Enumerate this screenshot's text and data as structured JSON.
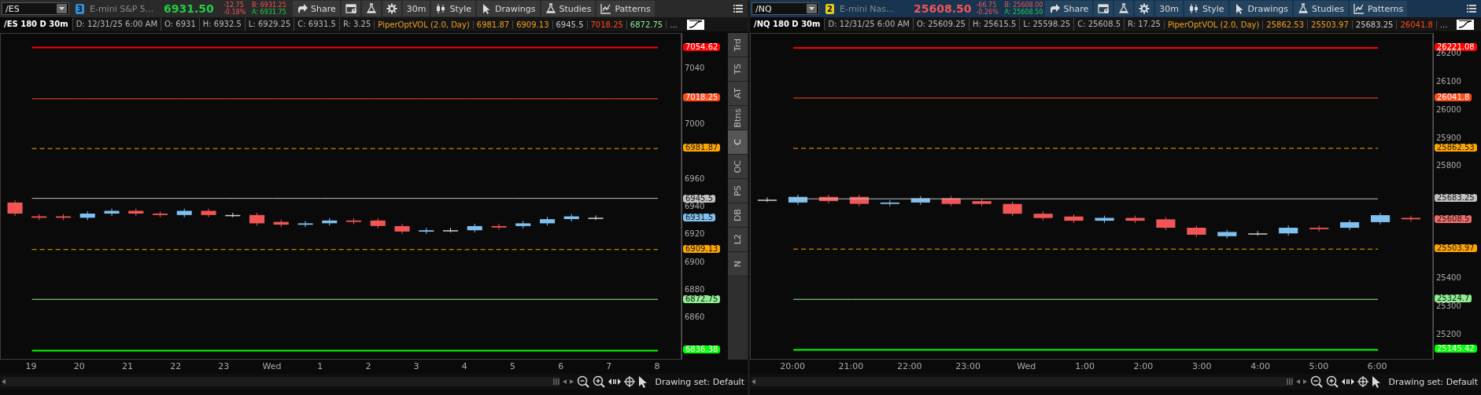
{
  "panels": [
    {
      "active": false,
      "symbol": "/ES",
      "link_badge": {
        "text": "3",
        "color": "#2f8fd8"
      },
      "description": "E-mini S&P 5...",
      "last": {
        "text": "6931.50",
        "up": true
      },
      "change": "-12.75",
      "change_pct": "-0.18%",
      "bid": "B: 6931.25",
      "ask": "A: 6931.75",
      "toolbar": [
        {
          "kind": "share",
          "label": "Share"
        },
        {
          "kind": "alerts"
        },
        {
          "kind": "lab"
        },
        {
          "kind": "settings"
        },
        {
          "kind": "aggregation",
          "label": "30m"
        },
        {
          "kind": "style",
          "label": "Style"
        },
        {
          "kind": "drawings",
          "label": "Drawings"
        },
        {
          "kind": "studies",
          "label": "Studies"
        },
        {
          "kind": "patterns",
          "label": "Patterns"
        }
      ],
      "info": {
        "title": "/ES 180 D 30m",
        "fields": [
          "D: 12/31/25 6:00 AM",
          "O: 6931",
          "H: 6932.5",
          "L: 6929.25",
          "C: 6931.5",
          "R: 3.25"
        ],
        "study": "PiperOptVOL (2.0, Day)",
        "study_values": [
          {
            "text": "6981.87",
            "color": "#f0a020"
          },
          {
            "text": "6909.13",
            "color": "#f0a020"
          },
          {
            "text": "6945.5",
            "color": "#c8c8c8"
          },
          {
            "text": "7018.25",
            "color": "#ff4a1a"
          },
          {
            "text": "6872.75",
            "color": "#90e890"
          }
        ],
        "more": "..."
      },
      "chart_data": {
        "type": "line",
        "categories": [
          "19",
          "20",
          "21",
          "22",
          "23",
          "Wed",
          "1",
          "2",
          "3",
          "4",
          "5",
          "6",
          "7",
          "8"
        ],
        "ylim": [
          6830,
          7065
        ],
        "yticks": [
          7040,
          7000,
          6960,
          6940,
          6920,
          6900,
          6880,
          6860
        ],
        "series": [
          {
            "name": "7054.62",
            "color": "#ff0000",
            "line_style": "solid",
            "values": [
              7055,
              7055,
              7055,
              7055,
              7055,
              7055,
              7055,
              7055,
              7055,
              7055,
              7055,
              7055,
              7055,
              7055
            ]
          },
          {
            "name": "7018.25",
            "color": "#ff4a1a",
            "line_style": "solid",
            "values": [
              7018,
              7018,
              7018,
              7018,
              7018,
              7018,
              7018,
              7018,
              7018,
              7018,
              7018,
              7018,
              7018,
              7018
            ]
          },
          {
            "name": "6981.87",
            "color": "#ffa500",
            "line_style": "dashed",
            "values": [
              6982,
              6982,
              6982,
              6982,
              6982,
              6982,
              6982,
              6982,
              6982,
              6982,
              6982,
              6982,
              6982,
              6982
            ]
          },
          {
            "name": "6945.5",
            "color": "#c0c0c0",
            "line_style": "solid",
            "values": [
              6946,
              6946,
              6946,
              6946,
              6946,
              6946,
              6946,
              6946,
              6946,
              6946,
              6946,
              6946,
              6946,
              6946
            ]
          },
          {
            "name": "6909.13",
            "color": "#ffa500",
            "line_style": "dashed",
            "values": [
              6909,
              6909,
              6909,
              6909,
              6909,
              6909,
              6909,
              6909,
              6909,
              6909,
              6909,
              6909,
              6909,
              6909
            ]
          },
          {
            "name": "6872.75",
            "color": "#90ee90",
            "line_style": "solid",
            "values": [
              6873,
              6873,
              6873,
              6873,
              6873,
              6873,
              6873,
              6873,
              6873,
              6873,
              6873,
              6873,
              6873,
              6873
            ]
          },
          {
            "name": "6836.38",
            "color": "#00ff00",
            "line_style": "solid",
            "values": [
              6836,
              6836,
              6836,
              6836,
              6836,
              6836,
              6836,
              6836,
              6836,
              6836,
              6836,
              6836,
              6836,
              6836
            ]
          }
        ],
        "annotations": [
          "6931.5"
        ]
      },
      "drawing_set": "Drawing set: Default"
    },
    {
      "active": true,
      "symbol": "/NQ",
      "link_badge": {
        "text": "2",
        "color": "#e8c81a"
      },
      "description": "E-mini Nas...",
      "last": {
        "text": "25608.50",
        "up": false
      },
      "change": "-66.75",
      "change_pct": "-0.26%",
      "bid": "B: 25608.00",
      "ask": "A: 25608.50",
      "toolbar": [
        {
          "kind": "share",
          "label": "Share"
        },
        {
          "kind": "alerts"
        },
        {
          "kind": "lab"
        },
        {
          "kind": "settings"
        },
        {
          "kind": "aggregation",
          "label": "30m"
        },
        {
          "kind": "style",
          "label": "Style"
        },
        {
          "kind": "drawings",
          "label": "Drawings"
        },
        {
          "kind": "studies",
          "label": "Studies"
        },
        {
          "kind": "patterns",
          "label": "Patterns"
        }
      ],
      "info": {
        "title": "/NQ 180 D 30m",
        "fields": [
          "D: 12/31/25 6:00 AM",
          "O: 25609.25",
          "H: 25615.5",
          "L: 25598.25",
          "C: 25608.5",
          "R: 17.25"
        ],
        "study": "PiperOptVOL (2.0, Day)",
        "study_values": [
          {
            "text": "25862.53",
            "color": "#f0a020"
          },
          {
            "text": "25503.97",
            "color": "#f0a020"
          },
          {
            "text": "25683.25",
            "color": "#c8c8c8"
          },
          {
            "text": "26041.8",
            "color": "#ff4a1a"
          }
        ],
        "more": "..."
      },
      "chart_data": {
        "type": "line",
        "categories": [
          "20:00",
          "21:00",
          "22:00",
          "23:00",
          "Wed",
          "1:00",
          "2:00",
          "3:00",
          "4:00",
          "5:00",
          "6:00"
        ],
        "ylim": [
          25113,
          26271
        ],
        "yticks": [
          26200,
          26100,
          26000,
          25900,
          25800,
          25400,
          25300,
          25200
        ],
        "series": [
          {
            "name": "26221.08",
            "color": "#ff0000",
            "line_style": "solid",
            "values": [
              26221,
              26221,
              26221,
              26221,
              26221,
              26221,
              26221,
              26221,
              26221,
              26221,
              26221
            ]
          },
          {
            "name": "26041.8",
            "color": "#ff4a1a",
            "line_style": "solid",
            "values": [
              26042,
              26042,
              26042,
              26042,
              26042,
              26042,
              26042,
              26042,
              26042,
              26042,
              26042
            ]
          },
          {
            "name": "25862.53",
            "color": "#ffa500",
            "line_style": "dashed",
            "values": [
              25863,
              25863,
              25863,
              25863,
              25863,
              25863,
              25863,
              25863,
              25863,
              25863,
              25863
            ]
          },
          {
            "name": "25683.25",
            "color": "#c0c0c0",
            "line_style": "solid",
            "values": [
              25683,
              25683,
              25683,
              25683,
              25683,
              25683,
              25683,
              25683,
              25683,
              25683,
              25683
            ]
          },
          {
            "name": "25503.97",
            "color": "#ffa500",
            "line_style": "dashed",
            "values": [
              25504,
              25504,
              25504,
              25504,
              25504,
              25504,
              25504,
              25504,
              25504,
              25504,
              25504
            ]
          },
          {
            "name": "25324.7",
            "color": "#90ee90",
            "line_style": "solid",
            "values": [
              25325,
              25325,
              25325,
              25325,
              25325,
              25325,
              25325,
              25325,
              25325,
              25325,
              25325
            ]
          },
          {
            "name": "25145.42",
            "color": "#00ff00",
            "line_style": "solid",
            "values": [
              25145,
              25145,
              25145,
              25145,
              25145,
              25145,
              25145,
              25145,
              25145,
              25145,
              25145
            ]
          }
        ],
        "annotations": [
          "25608.5"
        ]
      },
      "drawing_set": "Drawing set: Default"
    }
  ],
  "side_tabs": [
    {
      "label": "Trd",
      "selected": false
    },
    {
      "label": "TS",
      "selected": false
    },
    {
      "label": "AT",
      "selected": false
    },
    {
      "label": "Btns",
      "selected": false
    },
    {
      "label": "C",
      "selected": true
    },
    {
      "label": "OC",
      "selected": false
    },
    {
      "label": "PS",
      "selected": false
    },
    {
      "label": "DB",
      "selected": false
    },
    {
      "label": "L2",
      "selected": false
    },
    {
      "label": "N",
      "selected": false
    }
  ]
}
